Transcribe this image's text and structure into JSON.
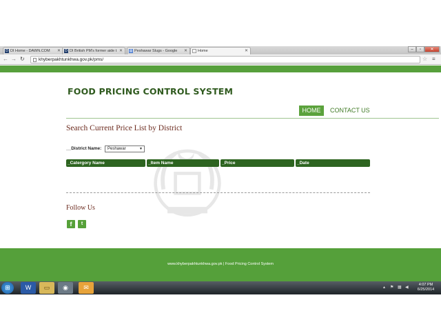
{
  "browser": {
    "tabs": [
      {
        "label": "DI Home - DAWN.COM",
        "favicon": "D",
        "color": "#1f3c6b"
      },
      {
        "label": "DI British PM's former aide t",
        "favicon": "D",
        "color": "#1f3c6b"
      },
      {
        "label": "Peshawar Slugs - Google",
        "favicon": "▤",
        "color": "#4a7bd1"
      },
      {
        "label": "Home",
        "favicon": "▫",
        "color": "#ffffff"
      }
    ],
    "url": "khyberpakhtunkhwa.gov.pk/pms/"
  },
  "site": {
    "title": "FOOD PRICING CONTROL SYSTEM",
    "nav": {
      "home": "HOME",
      "contact": "CONTACT US"
    },
    "heading": "Search Current Price List by District",
    "district_label": "__District Name:",
    "district_value": "Peshawar",
    "table_headers": [
      "_Catergory Name",
      "_Item Name",
      "_Price",
      "_Date"
    ],
    "follow": "Follow Us",
    "footer": "www.khyberpakhtunkhwa.gov.pk | Food Pricing Control System"
  },
  "taskbar": {
    "time": "4:07 PM",
    "date": "6/25/2014"
  },
  "colors": {
    "green": "#57a03c",
    "dark_green": "#2d6420",
    "heading": "#6b2a1e"
  }
}
